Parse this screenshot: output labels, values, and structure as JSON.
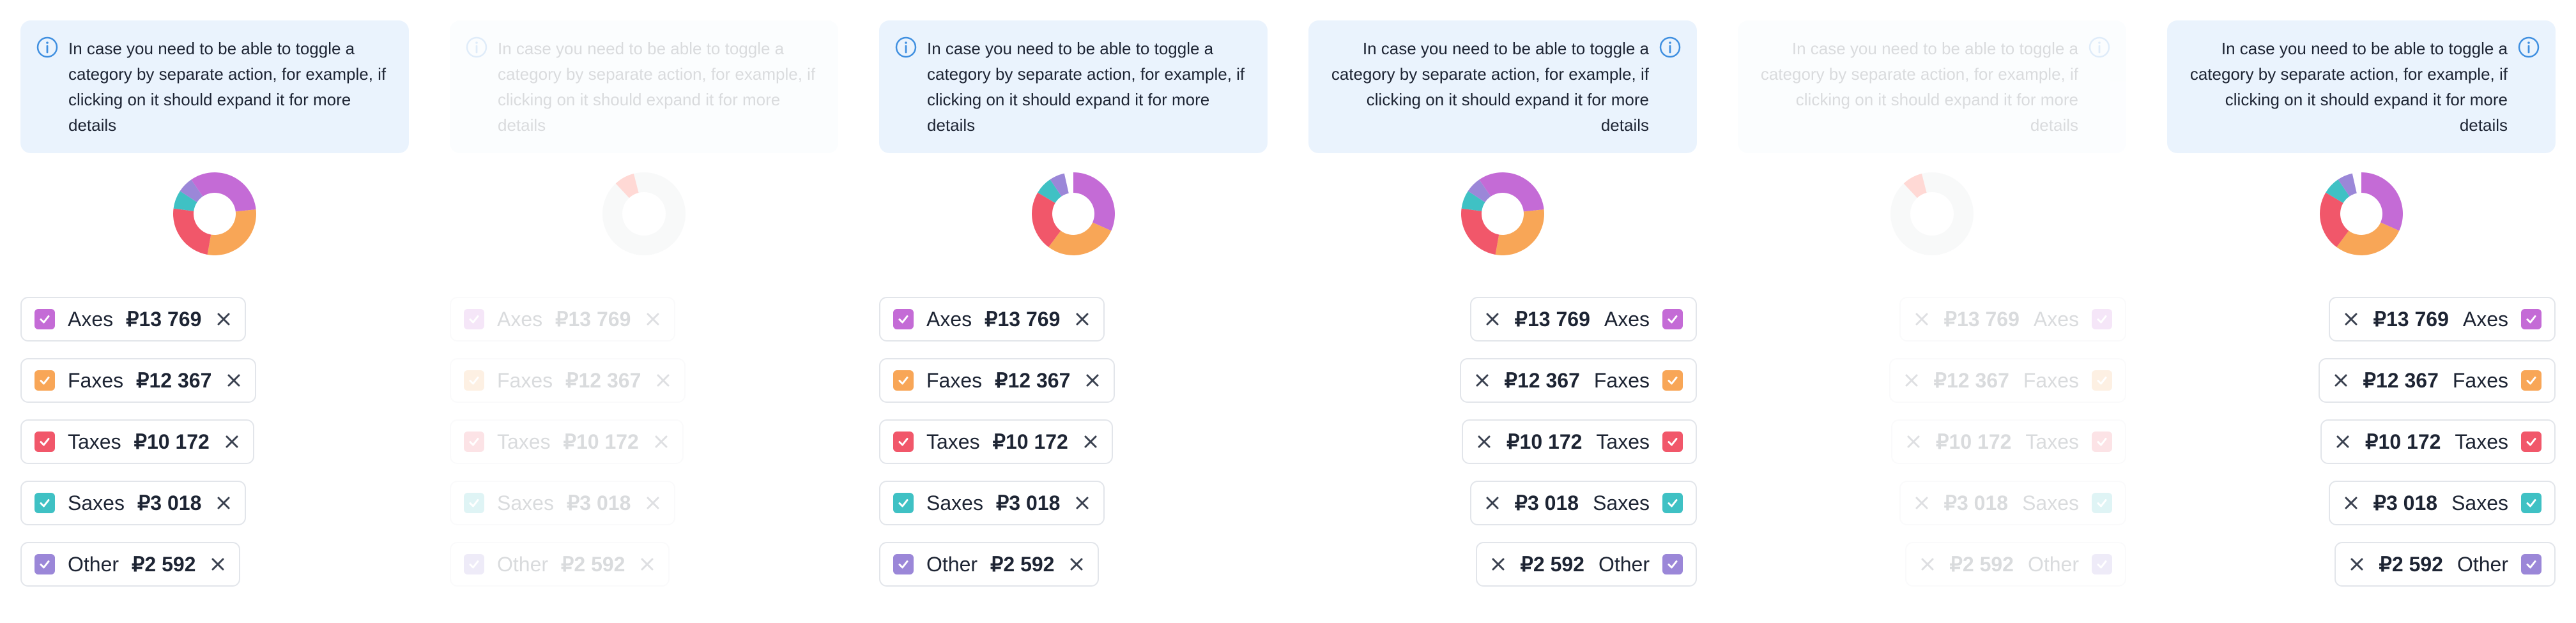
{
  "notice_text": "In case you need to be able to toggle a category by separate action, for example, if clicking on it should expand it for more details",
  "colors": {
    "notice_bg": "#eaf3fd",
    "info_icon": "#3f8fe0",
    "axes": "#c46bd6",
    "faxes": "#f8a657",
    "taxes": "#f1576a",
    "saxes": "#3fc1c4",
    "other": "#9b87d8",
    "disabled_slice": "#ff1a00"
  },
  "categories": [
    {
      "label": "Axes",
      "amount": "₽13 769",
      "value": 13769,
      "color": "#c46bd6"
    },
    {
      "label": "Faxes",
      "amount": "₽12 367",
      "value": 12367,
      "color": "#f8a657"
    },
    {
      "label": "Taxes",
      "amount": "₽10 172",
      "value": 10172,
      "color": "#f1576a"
    },
    {
      "label": "Saxes",
      "amount": "₽3 018",
      "value": 3018,
      "color": "#3fc1c4"
    },
    {
      "label": "Other",
      "amount": "₽2 592",
      "value": 2592,
      "color": "#9b87d8"
    }
  ],
  "panels": [
    {
      "state": "default",
      "direction": "ltr"
    },
    {
      "state": "disabled",
      "direction": "ltr"
    },
    {
      "state": "hover",
      "direction": "ltr"
    },
    {
      "state": "default",
      "direction": "rtl"
    },
    {
      "state": "disabled",
      "direction": "rtl"
    },
    {
      "state": "hover",
      "direction": "rtl"
    }
  ]
}
